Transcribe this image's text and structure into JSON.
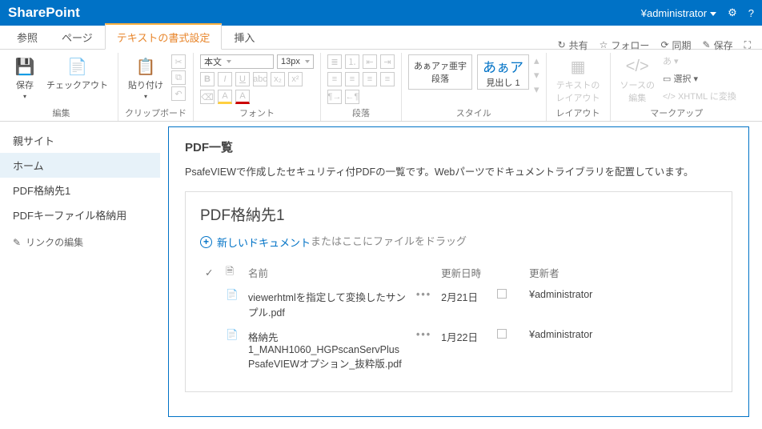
{
  "topbar": {
    "brand": "SharePoint",
    "user": "¥administrator"
  },
  "pageactions": {
    "share": "共有",
    "follow": "フォロー",
    "sync": "同期",
    "save": "保存"
  },
  "tabs": [
    "参照",
    "ページ",
    "テキストの書式設定",
    "挿入"
  ],
  "tabs_active": 2,
  "ribbon": {
    "edit": {
      "save": "保存",
      "checkout": "チェックアウト",
      "label": "編集"
    },
    "clipboard": {
      "paste": "貼り付け",
      "label": "クリップボード"
    },
    "font": {
      "dropdown": "本文",
      "size": "13px",
      "label": "フォント"
    },
    "paragraph": {
      "label": "段落"
    },
    "styles": {
      "s1": "あぁアァ亜宇",
      "s1b": "段落",
      "s2": "あぁア",
      "s2b": "見出し 1",
      "label": "スタイル"
    },
    "layout": {
      "btn": "テキストの\nレイアウト",
      "label": "レイアウト"
    },
    "markup": {
      "src": "ソースの\n編集",
      "select": "選択",
      "xhtml": "XHTML に変換",
      "label": "マークアップ"
    }
  },
  "leftnav": {
    "items": [
      "親サイト",
      "ホーム",
      "PDF格納先1",
      "PDFキーファイル格納用"
    ],
    "active": 1,
    "edit": "リンクの編集"
  },
  "panel": {
    "title": "PDF一覧",
    "desc": "PsafeVIEWで作成したセキュリティ付PDFの一覧です。Webパーツでドキュメントライブラリを配置しています。",
    "list_title": "PDF格納先1",
    "newdoc": "新しいドキュメント",
    "dragtext": "またはここにファイルをドラッグ",
    "cols": {
      "name": "名前",
      "modified": "更新日時",
      "modifiedby": "更新者"
    },
    "rows": [
      {
        "name": "viewerhtmlを指定して変換したサンプル.pdf",
        "modified": "2月21日",
        "modifiedby": "¥administrator"
      },
      {
        "name": "格納先1_MANH1060_HGPscanServPlus PsafeVIEWオプション_抜粋版.pdf",
        "modified": "1月22日",
        "modifiedby": "¥administrator"
      }
    ]
  }
}
